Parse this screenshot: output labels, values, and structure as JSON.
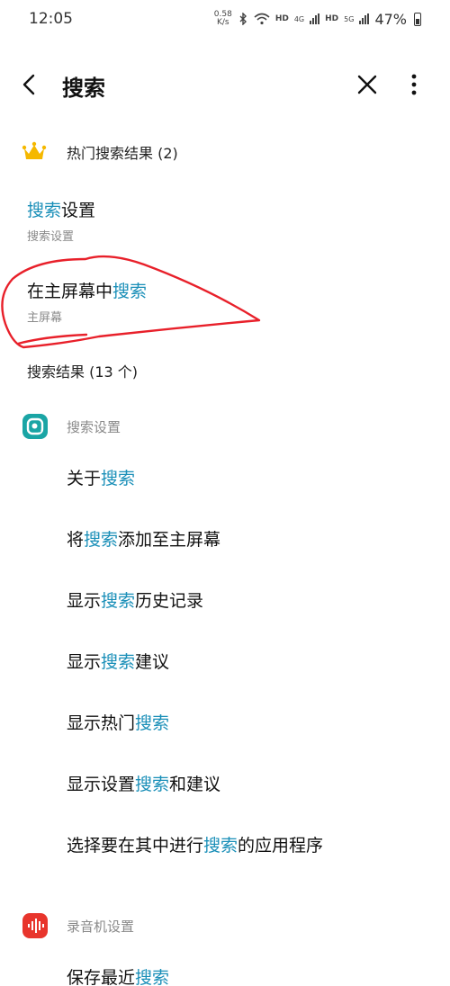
{
  "status_bar": {
    "time": "12:05",
    "net_speed_value": "0.58",
    "net_speed_unit": "K/s",
    "hd1": "HD",
    "net1": "4G",
    "hd2": "HD",
    "net2": "5G",
    "battery": "47%"
  },
  "header": {
    "title": "搜索"
  },
  "hot": {
    "label": "热门搜索结果 (2)",
    "items": [
      {
        "title_pre": "",
        "title_hl": "搜索",
        "title_post": "设置",
        "subtitle": "搜索设置"
      },
      {
        "title_pre": "在主屏幕中",
        "title_hl": "搜索",
        "title_post": "",
        "subtitle": "主屏幕"
      }
    ]
  },
  "results": {
    "label": "搜索结果 (13 个)",
    "groups": [
      {
        "label": "搜索设置",
        "items": [
          {
            "pre": "关于",
            "hl": "搜索",
            "post": ""
          },
          {
            "pre": "将",
            "hl": "搜索",
            "post": "添加至主屏幕"
          },
          {
            "pre": "显示",
            "hl": "搜索",
            "post": "历史记录"
          },
          {
            "pre": "显示",
            "hl": "搜索",
            "post": "建议"
          },
          {
            "pre": "显示热门",
            "hl": "搜索",
            "post": ""
          },
          {
            "pre": "显示设置",
            "hl": "搜索",
            "post": "和建议"
          },
          {
            "pre": "选择要在其中进行",
            "hl": "搜索",
            "post": "的应用程序"
          }
        ]
      },
      {
        "label": "录音机设置",
        "items": [
          {
            "pre": "保存最近",
            "hl": "搜索",
            "post": ""
          }
        ]
      }
    ]
  },
  "colors": {
    "highlight": "#1a8fb8",
    "search_app_icon": "#1aa5a5",
    "recorder_app_icon": "#e8352c",
    "annotation": "#e8202a",
    "crown": "#f5b800"
  },
  "icons": {
    "back": "chevron-left-icon",
    "close": "close-icon",
    "more": "more-vertical-icon",
    "hot": "crown-icon",
    "search_app": "search-app-icon",
    "recorder_app": "recorder-app-icon"
  }
}
